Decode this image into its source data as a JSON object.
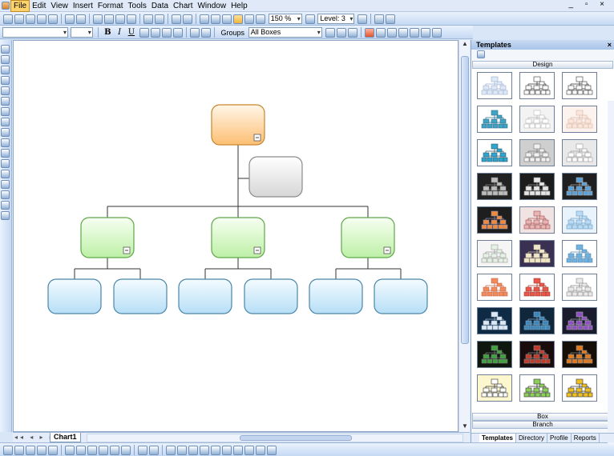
{
  "menubar": {
    "items": [
      "File",
      "Edit",
      "View",
      "Insert",
      "Format",
      "Tools",
      "Data",
      "Chart",
      "Window",
      "Help"
    ],
    "window_controls": "_ ▫ ×"
  },
  "toolbar1": {
    "zoom_value": "150 %",
    "level_value": "Level: 3"
  },
  "toolbar2": {
    "font_name": "",
    "font_size": "",
    "bold": "B",
    "italic": "I",
    "underline": "U",
    "groups_label": "Groups",
    "groups_value": "All Boxes"
  },
  "canvas": {
    "sheet_tab": "Chart1"
  },
  "templates_panel": {
    "title": "Templates",
    "close": "×",
    "section_design": "Design",
    "section_box": "Box",
    "section_branch": "Branch",
    "tabs": [
      "Templates",
      "Directory",
      "Profile",
      "Reports"
    ],
    "active_tab": "Templates",
    "thumbnails": [
      {
        "bg": "#ffffff",
        "box": "#dfe8f6",
        "line": "#9aaed0"
      },
      {
        "bg": "#ffffff",
        "box": "#ffffff",
        "line": "#333333"
      },
      {
        "bg": "#ffffff",
        "box": "#ffffff",
        "line": "#333333"
      },
      {
        "bg": "#ffffff",
        "box": "#3fa3c4",
        "line": "#2f6f88"
      },
      {
        "bg": "#f3f3f3",
        "box": "#ffffff",
        "line": "#b7b7b7"
      },
      {
        "bg": "#fdf3ee",
        "box": "#fbe6dc",
        "line": "#d8b7a8"
      },
      {
        "bg": "#ffffff",
        "box": "#2aa6d0",
        "line": "#3c5a6a"
      },
      {
        "bg": "#cfcfcf",
        "box": "#f1f1f1",
        "line": "#777777"
      },
      {
        "bg": "#e9e9e9",
        "box": "#ffffff",
        "line": "#999999"
      },
      {
        "bg": "#222222",
        "box": "#bcbcbc",
        "line": "#888888"
      },
      {
        "bg": "#1c1c1c",
        "box": "#e6e6e6",
        "line": "#999999"
      },
      {
        "bg": "#202020",
        "box": "#5aa0d8",
        "line": "#aaaaaa"
      },
      {
        "bg": "#1e1e1e",
        "box": "#f08a3a",
        "line": "#8888aa"
      },
      {
        "bg": "#f2e3e3",
        "box": "#e8b5b5",
        "line": "#a05050"
      },
      {
        "bg": "#e8f3fb",
        "box": "#b9dbf3",
        "line": "#6a9cc2"
      },
      {
        "bg": "#f5f5f5",
        "box": "#e6f2e6",
        "line": "#999999"
      },
      {
        "bg": "#3a3052",
        "box": "#efe6c8",
        "line": "#cfc6a5"
      },
      {
        "bg": "#ffffff",
        "box": "#6fb2e0",
        "line": "#5588aa"
      },
      {
        "bg": "#ffffff",
        "box": "#f28a5c",
        "line": "#c26a4a"
      },
      {
        "bg": "#ffffff",
        "box": "#e8574a",
        "line": "#a03a30"
      },
      {
        "bg": "#ffffff",
        "box": "#e9e9e9",
        "line": "#888888"
      },
      {
        "bg": "#0f2a44",
        "box": "#dde8f3",
        "line": "#9fb8d0"
      },
      {
        "bg": "#10263a",
        "box": "#3f86b8",
        "line": "#7da7c8"
      },
      {
        "bg": "#1b1b2e",
        "box": "#8e4fc0",
        "line": "#aaaaaa"
      },
      {
        "bg": "#0e160e",
        "box": "#3fa13f",
        "line": "#777777"
      },
      {
        "bg": "#1a0c0c",
        "box": "#c23a2a",
        "line": "#888888"
      },
      {
        "bg": "#160f08",
        "box": "#e07a1f",
        "line": "#888888"
      },
      {
        "bg": "#fdf7cf",
        "box": "#ffffff",
        "line": "#333333"
      },
      {
        "bg": "#ffffff",
        "box": "#8ccf5a",
        "line": "#333333"
      },
      {
        "bg": "#ffffff",
        "box": "#f0c020",
        "line": "#333333"
      }
    ]
  },
  "chart": {
    "boxes": [
      {
        "id": "root",
        "style": "orange",
        "collapse_icon": true
      },
      {
        "id": "assistant",
        "style": "gray",
        "collapse_icon": false
      },
      {
        "id": "manager-1",
        "style": "green",
        "collapse_icon": true
      },
      {
        "id": "manager-2",
        "style": "green",
        "collapse_icon": true
      },
      {
        "id": "manager-3",
        "style": "green",
        "collapse_icon": true
      },
      {
        "id": "leaf-1",
        "style": "blue",
        "collapse_icon": false
      },
      {
        "id": "leaf-2",
        "style": "blue",
        "collapse_icon": false
      },
      {
        "id": "leaf-3",
        "style": "blue",
        "collapse_icon": false
      },
      {
        "id": "leaf-4",
        "style": "blue",
        "collapse_icon": false
      },
      {
        "id": "leaf-5",
        "style": "blue",
        "collapse_icon": false
      },
      {
        "id": "leaf-6",
        "style": "blue",
        "collapse_icon": false
      }
    ],
    "box_colors": {
      "orange": [
        "#fff6e8",
        "#fdbf73",
        "#c6862f"
      ],
      "gray": [
        "#ffffff",
        "#d6d6d6",
        "#8a8a8a"
      ],
      "green": [
        "#f7fff2",
        "#bdf0a6",
        "#5fa648"
      ],
      "blue": [
        "#f4fbff",
        "#b6def6",
        "#4a86a8"
      ]
    }
  }
}
